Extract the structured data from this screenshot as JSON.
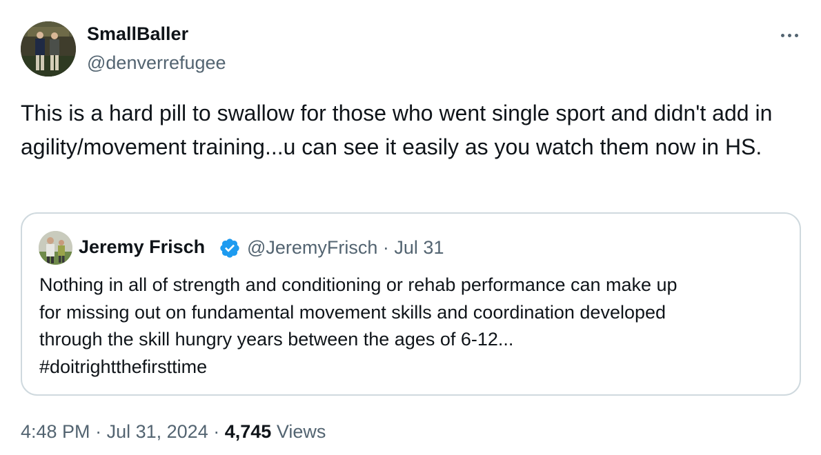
{
  "author": {
    "name": "SmallBaller",
    "handle": "@denverrefugee"
  },
  "tweet": {
    "text": "This is a hard pill to swallow for those who went single sport and didn't add in agility/movement training...u can see it easily as you watch them now in HS."
  },
  "quoted_tweet": {
    "name": "Jeremy Frisch",
    "verified": true,
    "handle_and_date": "@JeremyFrisch · Jul 31",
    "text_lines": [
      "Nothing in all of strength and conditioning or rehab performance can make up",
      "for missing out on fundamental movement skills and coordination developed",
      "through the skill hungry years between the ages of 6-12..."
    ],
    "hashtag": "#doitrightthefirsttime"
  },
  "meta": {
    "time": "4:48 PM",
    "separator": "·",
    "date": "Jul 31, 2024",
    "views_count": "4,745",
    "views_label": "Views"
  },
  "icons": {
    "more": "more-horizontal-icon",
    "verified": "verified-badge-icon"
  },
  "colors": {
    "text_primary": "#0f1419",
    "text_secondary": "#536471",
    "border": "#cfd9de",
    "verified_blue": "#1d9bf0"
  }
}
